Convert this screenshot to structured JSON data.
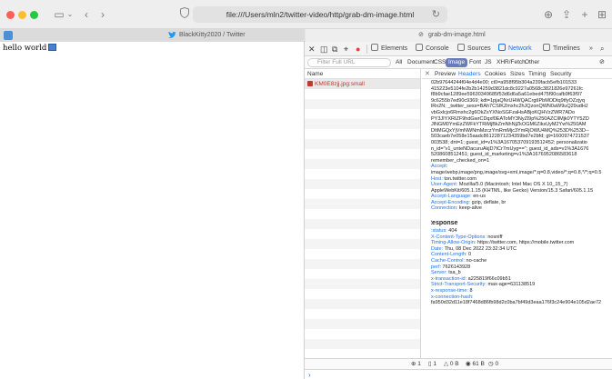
{
  "browser": {
    "address": "file:///Users/mln2/twitter-video/http/grab-dm-image.html",
    "left_tab_title": "BlackKitty2020 / Twitter",
    "right_tab_title": "grab-dm-image.html"
  },
  "page": {
    "text": "hello world"
  },
  "devtools": {
    "tabs": [
      "Elements",
      "Console",
      "Sources",
      "Network",
      "Timelines",
      "»"
    ],
    "active_tab": "Network",
    "filter": {
      "placeholder": "Filter Full URL",
      "types": [
        "All",
        "Document",
        "CSS",
        "Image",
        "Font",
        "JS",
        "XHR/Fetch",
        "Other"
      ],
      "active_type": "Image"
    },
    "name_header": "Name",
    "selected_request": "KM0E8zjj.jpg:small",
    "detail_tabs": [
      "Preview",
      "Headers",
      "Cookies",
      "Sizes",
      "Timing",
      "Security"
    ],
    "active_detail_tab": "Headers",
    "request_header_lines": [
      "02b97644244f04e4d4e00; ct0=a958f95b304a239facb5efb101533",
      "415223e5104fe2b2b14259d3821dc8c9227a0568c3821826e97261fc",
      "f8b9cfae1289ee59630349685f53d6d6a5a61ebed475f90cafb9f63f97",
      "9c6255b7ed90c9369; kdt=1pjaQNrUHWQACrgtIPbMODtq9tfyOZzjyq",
      "lRn2N; _twitter_sess=BAh7CSIKZmxhc2hJQzonQWN0aW9uQ29udHJ",
      "vbGxlcjo6Rmxhc2g6OkZsYXNoSGFzaHsABjoKQHVzZWR7ADo",
      "PY3JIYXRIZF9hdGwrCDqxf0EAToMY3NyZl9p%250AZCIlMjk0YTY5ZD",
      "JlNGM0YmEzZWFkYTRiMjBkZmNhNjZkOGM6ZiksUyM2Yw%250AM",
      "DItMGQxYjVmNWNmMzczYmRmMjc3YmRjOWU4MQ%253D%253D--",
      "503caeb7e058e15aadc86122871234359bd7e2bfd; gt=1600974721537",
      "003538; dnt=1; guest_id=v1%3A167053709193512452; personalizatio",
      "n_id=\"v1_unteNDacuruAkjD7tCr7mUyg==\"; guest_id_ads=v1%3A1676",
      "5208608512451; guest_id_marketing=v1%3A1676952086583618",
      "remember_checked_on=1"
    ],
    "request_headers": [
      {
        "key": "Accept",
        "value": "image/webp,image/png,image/svg+xml,image/*;q=0.8,video/*;q=0.8,*/*;q=0.5"
      },
      {
        "key": "Host",
        "value": "ton.twitter.com"
      },
      {
        "key": "User-Agent",
        "value": "Mozilla/5.0 (Macintosh; Intel Mac OS X 10_15_7) AppleWebKit/605.1.15 (KHTML, like Gecko) Version/15.3 Safari/605.1.15"
      },
      {
        "key": "Accept-Language",
        "value": "en-us"
      },
      {
        "key": "Accept-Encoding",
        "value": "gzip, deflate, br"
      },
      {
        "key": "Connection",
        "value": "keep-alive"
      }
    ],
    "response_title": "Response",
    "response_headers": [
      {
        "key": ":status",
        "value": "404"
      },
      {
        "key": "X-Content-Type-Options",
        "value": "nosniff"
      },
      {
        "key": "Timing-Allow-Origin",
        "value": "https://twitter.com, https://mobile.twitter.com"
      },
      {
        "key": "Date",
        "value": "Thu, 08 Dec 2022 23:32:34 UTC"
      },
      {
        "key": "Content-Length",
        "value": "0"
      },
      {
        "key": "Cache-Control",
        "value": "no-cache"
      },
      {
        "key": "perf",
        "value": "7626143928"
      },
      {
        "key": "Server",
        "value": "tsa_b"
      },
      {
        "key": "x-transaction-id",
        "value": "a225819f66c09b51"
      },
      {
        "key": "Strict-Transport-Security",
        "value": "max-age=631138519"
      },
      {
        "key": "x-response-time",
        "value": "8"
      },
      {
        "key": "x-connection-hash",
        "value": "fa950d32d11e18f7468d86fb98d2c0ba7bf49d3eaa176f3c24e904e105d2ae72"
      }
    ],
    "status": {
      "requests": "1",
      "resources": "1",
      "transferred": "0 B",
      "size": "61 B",
      "time": "0"
    }
  }
}
